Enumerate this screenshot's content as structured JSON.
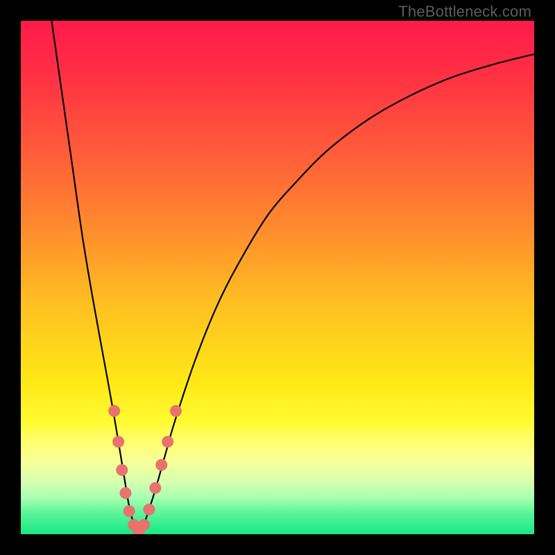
{
  "watermark": "TheBottleneck.com",
  "colors": {
    "frame": "#000000",
    "gradient_stops": [
      {
        "offset": 0.0,
        "color": "#ff1a4b"
      },
      {
        "offset": 0.1,
        "color": "#ff2f44"
      },
      {
        "offset": 0.25,
        "color": "#ff5a3a"
      },
      {
        "offset": 0.4,
        "color": "#ff8a2e"
      },
      {
        "offset": 0.55,
        "color": "#ffbf22"
      },
      {
        "offset": 0.7,
        "color": "#ffe716"
      },
      {
        "offset": 0.78,
        "color": "#fffb30"
      },
      {
        "offset": 0.82,
        "color": "#ffff70"
      },
      {
        "offset": 0.86,
        "color": "#f7ff9a"
      },
      {
        "offset": 0.9,
        "color": "#d4ffb0"
      },
      {
        "offset": 0.93,
        "color": "#a6ffb0"
      },
      {
        "offset": 0.96,
        "color": "#58f598"
      },
      {
        "offset": 1.0,
        "color": "#17e885"
      }
    ],
    "curve": "#000000",
    "marker_fill": "#e8736e",
    "marker_stroke": "#e8736e"
  },
  "chart_data": {
    "type": "line",
    "title": "",
    "xlabel": "",
    "ylabel": "",
    "xlim": [
      0,
      100
    ],
    "ylim": [
      0,
      100
    ],
    "grid": false,
    "legend": false,
    "series": [
      {
        "name": "bottleneck-curve",
        "x": [
          6,
          8,
          10,
          12,
          14,
          16,
          18,
          20,
          21,
          22,
          23,
          24,
          26,
          28,
          30,
          34,
          38,
          42,
          48,
          54,
          60,
          68,
          76,
          84,
          92,
          100
        ],
        "values": [
          100,
          86,
          72,
          58,
          46,
          35,
          24,
          12,
          6,
          2,
          0,
          2,
          8,
          15,
          22,
          34,
          44,
          52,
          62,
          69,
          75,
          81,
          85.5,
          89,
          91.5,
          93.5
        ]
      }
    ],
    "markers": [
      {
        "x": 18.2,
        "y": 24.0
      },
      {
        "x": 19.0,
        "y": 18.0
      },
      {
        "x": 19.7,
        "y": 12.5
      },
      {
        "x": 20.4,
        "y": 8.0
      },
      {
        "x": 21.1,
        "y": 4.5
      },
      {
        "x": 22.0,
        "y": 1.8
      },
      {
        "x": 23.0,
        "y": 0.5
      },
      {
        "x": 24.0,
        "y": 1.8
      },
      {
        "x": 25.0,
        "y": 4.8
      },
      {
        "x": 26.2,
        "y": 9.0
      },
      {
        "x": 27.4,
        "y": 13.5
      },
      {
        "x": 28.6,
        "y": 18.0
      },
      {
        "x": 30.2,
        "y": 24.0
      }
    ],
    "marker_radius": 8
  }
}
